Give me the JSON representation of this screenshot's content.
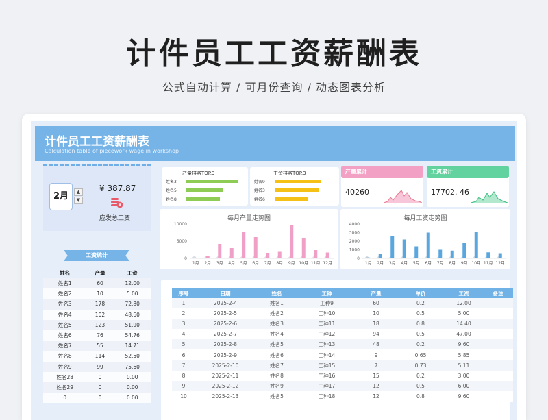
{
  "hero": {
    "title": "计件员工工资薪酬表",
    "subtitle": "公式自动计算 / 可月份查询 / 动态图表分析"
  },
  "banner": {
    "title": "计件员工工资薪酬表",
    "subtitle_en": "Calculation table of piecework wage in workshop"
  },
  "month_picker": {
    "value": "2月",
    "up": "▲",
    "down": "▼"
  },
  "summary": {
    "amount": "¥ 387.87",
    "label": "应发总工资",
    "icon": "coin-stack-icon"
  },
  "wage_stats": {
    "title": "工资统计",
    "headers": [
      "姓名",
      "产量",
      "工资"
    ],
    "rows": [
      [
        "姓名1",
        "60",
        "12.00"
      ],
      [
        "姓名2",
        "10",
        "5.00"
      ],
      [
        "姓名3",
        "178",
        "72.80"
      ],
      [
        "姓名4",
        "102",
        "48.60"
      ],
      [
        "姓名5",
        "123",
        "51.90"
      ],
      [
        "姓名6",
        "76",
        "54.76"
      ],
      [
        "姓名7",
        "55",
        "14.71"
      ],
      [
        "姓名8",
        "114",
        "52.50"
      ],
      [
        "姓名9",
        "99",
        "75.60"
      ],
      [
        "姓名28",
        "0",
        "0.00"
      ],
      [
        "姓名29",
        "0",
        "0.00"
      ],
      [
        "0",
        "0",
        "0.00"
      ]
    ]
  },
  "top3_output": {
    "title": "产量排名TOP.3",
    "items": [
      {
        "label": "姓名3",
        "value": 178
      },
      {
        "label": "姓名5",
        "value": 123
      },
      {
        "label": "姓名8",
        "value": 114
      }
    ],
    "color": "#8fcc55"
  },
  "top3_wage": {
    "title": "工资排名TOP.3",
    "items": [
      {
        "label": "姓名9",
        "value": 75.6
      },
      {
        "label": "姓名3",
        "value": 72.8
      },
      {
        "label": "姓名6",
        "value": 54.76
      }
    ],
    "color": "#f5c116"
  },
  "output_total": {
    "title": "产量累计",
    "value": "40260",
    "color": "#f2a1c4"
  },
  "wage_total": {
    "title": "工资累计",
    "value": "17702. 46",
    "color": "#62d29e"
  },
  "chart_data": [
    {
      "type": "bar",
      "title": "每月产量走势图",
      "categories": [
        "1月",
        "2月",
        "3月",
        "4月",
        "5月",
        "6月",
        "7月",
        "8月",
        "9月",
        "10月",
        "11月",
        "12月"
      ],
      "ylim": [
        0,
        10000
      ],
      "yticks": [
        "10000",
        "5000",
        "0"
      ],
      "values": [
        200,
        700,
        4200,
        3000,
        7600,
        6200,
        1600,
        1900,
        9800,
        5800,
        2400,
        1700
      ],
      "color": "#f0a0c6"
    },
    {
      "type": "bar",
      "title": "每月工资走势图",
      "categories": [
        "1月",
        "2月",
        "3月",
        "4月",
        "5月",
        "6月",
        "7月",
        "8月",
        "9月",
        "10月",
        "11月",
        "12月"
      ],
      "ylim": [
        0,
        4000
      ],
      "yticks": [
        "4000",
        "3000",
        "2000",
        "1000",
        "0"
      ],
      "values": [
        100,
        500,
        2600,
        2200,
        1400,
        3000,
        1000,
        900,
        1800,
        3100,
        700,
        600
      ],
      "color": "#5aa6de"
    }
  ],
  "detail_table": {
    "headers": [
      "序号",
      "日期",
      "姓名",
      "工种",
      "产量",
      "单价",
      "工资",
      "备注"
    ],
    "rows": [
      [
        "1",
        "2025-2-4",
        "姓名1",
        "工种9",
        "60",
        "0.2",
        "12.00",
        ""
      ],
      [
        "2",
        "2025-2-5",
        "姓名2",
        "工种10",
        "10",
        "0.5",
        "5.00",
        ""
      ],
      [
        "3",
        "2025-2-6",
        "姓名3",
        "工种11",
        "18",
        "0.8",
        "14.40",
        ""
      ],
      [
        "4",
        "2025-2-7",
        "姓名4",
        "工种12",
        "94",
        "0.5",
        "47.00",
        ""
      ],
      [
        "5",
        "2025-2-8",
        "姓名5",
        "工种13",
        "48",
        "0.2",
        "9.60",
        ""
      ],
      [
        "6",
        "2025-2-9",
        "姓名6",
        "工种14",
        "9",
        "0.65",
        "5.85",
        ""
      ],
      [
        "7",
        "2025-2-10",
        "姓名7",
        "工种15",
        "7",
        "0.73",
        "5.11",
        ""
      ],
      [
        "8",
        "2025-2-11",
        "姓名8",
        "工种16",
        "15",
        "0.2",
        "3.00",
        ""
      ],
      [
        "9",
        "2025-2-12",
        "姓名9",
        "工种17",
        "12",
        "0.5",
        "6.00",
        ""
      ],
      [
        "10",
        "2025-2-13",
        "姓名5",
        "工种18",
        "12",
        "0.8",
        "9.60",
        ""
      ]
    ]
  }
}
